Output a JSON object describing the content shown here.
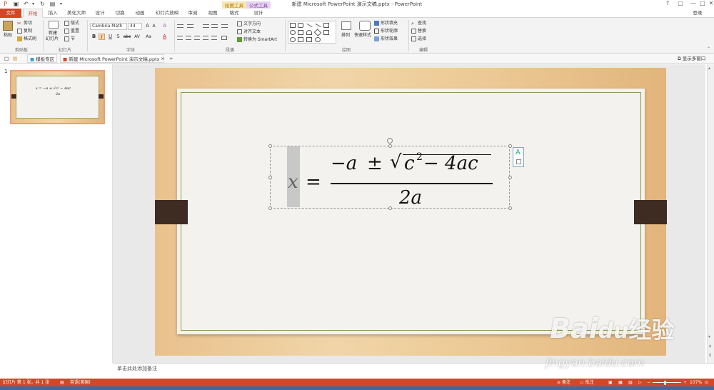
{
  "window": {
    "title": "新建 Microsoft PowerPoint 演示文稿.pptx - PowerPoint",
    "context_tabs": {
      "drawing_tools": "绘图工具",
      "equation_tools": "公式工具"
    },
    "controls": {
      "help": "?",
      "restore": "▢",
      "minimize": "—",
      "maximize": "□",
      "close": "✕"
    },
    "login": "登录"
  },
  "tabs": [
    "文件",
    "开始",
    "插入",
    "美化大师",
    "设计",
    "切换",
    "动画",
    "幻灯片放映",
    "审阅",
    "视图",
    "格式",
    "设计"
  ],
  "ribbon": {
    "clipboard": {
      "paste": "粘贴",
      "cut": "剪切",
      "copy": "复制",
      "format_painter": "格式刷",
      "label": "剪贴板"
    },
    "slides": {
      "new_slide": "新建",
      "new_slide2": "幻灯片",
      "layout": "版式",
      "reset": "重置",
      "section": "节",
      "label": "幻灯片"
    },
    "font": {
      "name": "Cambria Math",
      "size": "44",
      "grow": "A",
      "shrink": "A",
      "clear": "A",
      "bold": "B",
      "italic": "I",
      "underline": "U",
      "shadow": "S",
      "strike": "abc",
      "spacing": "AV",
      "case": "Aa",
      "color": "A",
      "label": "字体"
    },
    "paragraph": {
      "text_direction": "文字方向",
      "align_text": "对齐文本",
      "smartart": "转换为 SmartArt",
      "label": "段落"
    },
    "drawing": {
      "arrange": "排列",
      "quick_styles": "快速样式",
      "fill": "形状填充",
      "outline": "形状轮廓",
      "effects": "形状效果",
      "label": "绘图"
    },
    "editing": {
      "find": "查找",
      "replace": "替换",
      "select": "选择",
      "label": "编辑"
    }
  },
  "doc_tabs": {
    "template": "模板专区",
    "document": "新建 Microsoft PowerPoint 演示文稿.pptx",
    "close": "×",
    "add": "+",
    "show_multi": "显示多窗口"
  },
  "thumbnails": [
    {
      "number": "1",
      "formula_top": "x = −a ± √c² − 4ac",
      "formula_bottom": "2a"
    }
  ],
  "slide": {
    "equation": {
      "x": "x",
      "equals": "=",
      "minus_a": "−a",
      "pm": "±",
      "radical": "√",
      "c": "c",
      "exp": "2",
      "rest": " − 4ac",
      "den": "2a"
    },
    "format_badge": "A"
  },
  "notes": {
    "placeholder": "单击此处添加备注"
  },
  "status": {
    "slide_count": "幻灯片 第 1 张，共 1 张",
    "language": "英语(美国)",
    "notes": "备注",
    "comments": "批注",
    "zoom": "107%"
  },
  "watermark": {
    "brand": "Bai",
    "brand2": "经验",
    "paw": "du",
    "url": "jingyan.baidu.com"
  }
}
